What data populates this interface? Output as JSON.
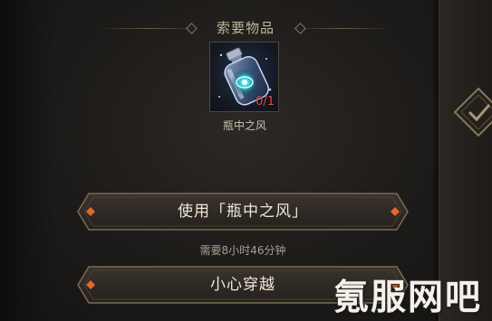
{
  "required_items": {
    "title": "索要物品",
    "item": {
      "name": "瓶中之风",
      "count": "0/1",
      "icon": "bottled-wind-icon"
    }
  },
  "actions": {
    "use_item_label": "使用「瓶中之风」",
    "time_requirement": "需要8小时46分钟",
    "careful_traverse_label": "小心穿越"
  },
  "watermark": {
    "text": "氪服网吧"
  },
  "colors": {
    "count_red": "#e0504a",
    "gold_border": "#8a7658",
    "ember_orange": "#e06a2a"
  }
}
